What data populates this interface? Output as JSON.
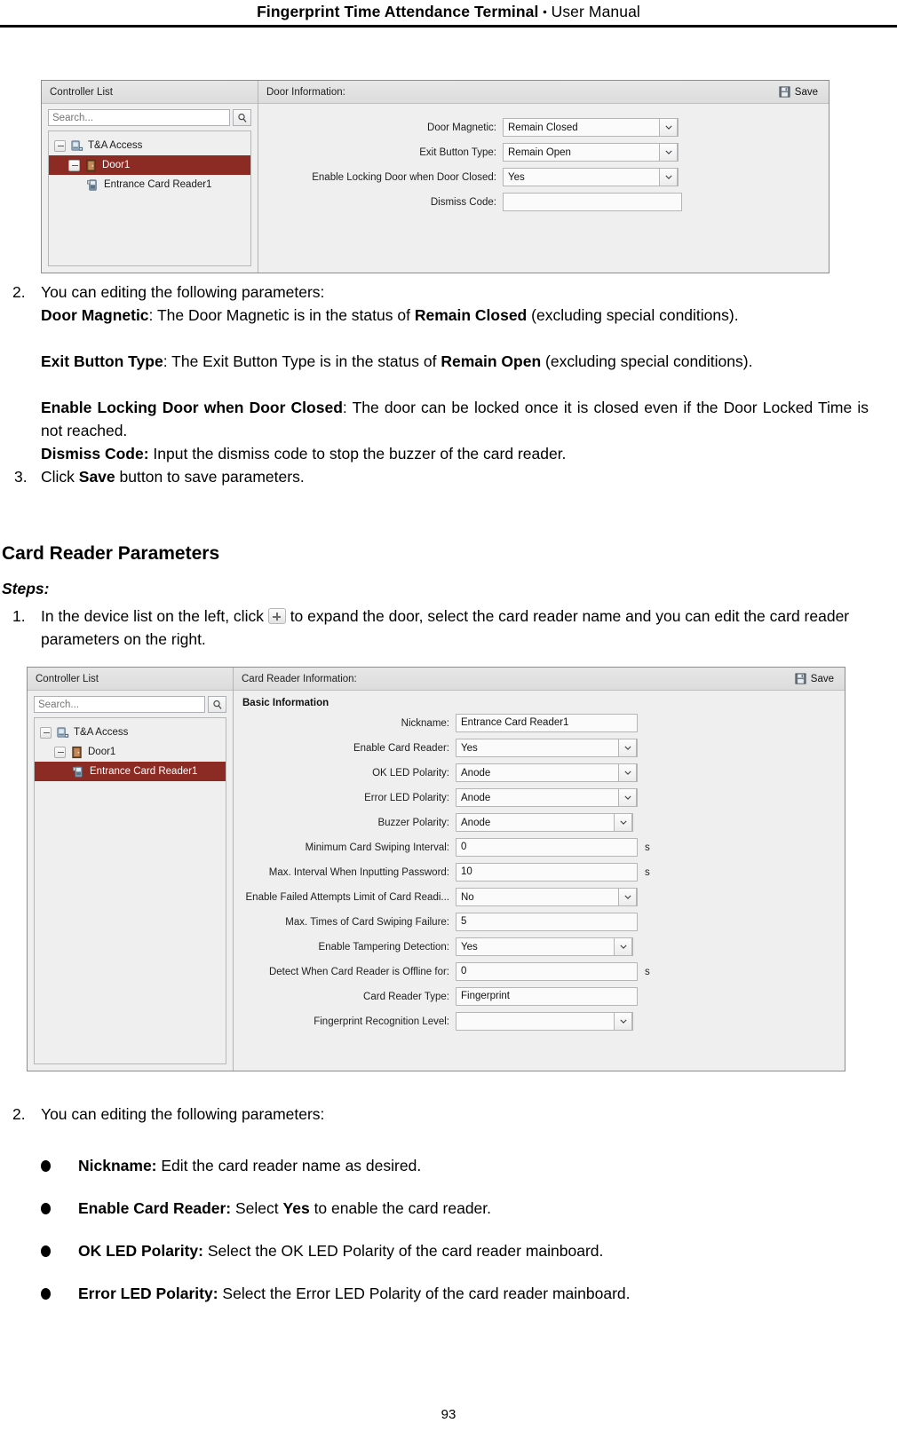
{
  "page": {
    "header_title_bold": "Fingerprint Time Attendance Terminal",
    "header_sep": "・",
    "header_title_rest": "User Manual",
    "page_number": "93"
  },
  "screenshot_door": {
    "left_pane": {
      "title": "Controller List",
      "search_placeholder": "Search...",
      "search_value": "",
      "search_icon": "magnifier-icon",
      "tree": [
        {
          "label": "T&A Access",
          "level": 1,
          "icon": "controller-icon",
          "expanded": true,
          "selected": false
        },
        {
          "label": "Door1",
          "level": 2,
          "icon": "door-icon",
          "expanded": true,
          "selected": true
        },
        {
          "label": "Entrance Card Reader1",
          "level": 3,
          "icon": "card-reader-icon",
          "expanded": null,
          "selected": false
        }
      ]
    },
    "right_pane": {
      "title": "Door Information:",
      "save_label": "Save",
      "save_icon": "floppy-save-icon",
      "fields": [
        {
          "label": "Door Magnetic:",
          "value": "Remain Closed",
          "type": "select",
          "unit": ""
        },
        {
          "label": "Exit Button Type:",
          "value": "Remain Open",
          "type": "select",
          "unit": ""
        },
        {
          "label": "Enable Locking Door when Door Closed:",
          "value": "Yes",
          "type": "select",
          "unit": ""
        },
        {
          "label": "Dismiss Code:",
          "value": "",
          "type": "text",
          "unit": ""
        }
      ]
    }
  },
  "body_1": {
    "step2_num": "2.",
    "step2_text": "You can editing the following parameters:",
    "p_door_magnetic_label": "Door Magnetic",
    "p_door_magnetic_text_a": ": The Door Magnetic is in the status of ",
    "p_door_magnetic_bold": "Remain Closed",
    "p_door_magnetic_text_b": " (excluding special conditions).",
    "p_exit_label": "Exit Button Type",
    "p_exit_text_a": ": The Exit Button Type is in the status of ",
    "p_exit_bold": "Remain Open",
    "p_exit_text_b": " (excluding special conditions).",
    "p_lock_label": "Enable Locking Door when Door Closed",
    "p_lock_text": ": The door can be locked once it is closed even if the Door Locked Time is not reached.",
    "p_dismiss_label": "Dismiss Code:",
    "p_dismiss_text": " Input the dismiss code to stop the buzzer of the card reader.",
    "step3_num": "3.",
    "step3_text_a": "Click ",
    "step3_bold": "Save",
    "step3_text_b": " button to save parameters."
  },
  "section": {
    "heading": "Card Reader Parameters",
    "steps_label": "Steps:",
    "step1_num": "1.",
    "step1_text_a": "In the device list on the left, click ",
    "step1_icon": "expand-plus-icon",
    "step1_text_b": " to expand the door, select the card reader name and you can edit the card reader parameters on the right."
  },
  "screenshot_reader": {
    "left_pane": {
      "title": "Controller List",
      "search_placeholder": "Search...",
      "search_value": "",
      "search_icon": "magnifier-icon",
      "tree": [
        {
          "label": "T&A Access",
          "level": 1,
          "icon": "controller-icon",
          "expanded": true,
          "selected": false
        },
        {
          "label": "Door1",
          "level": 2,
          "icon": "door-icon",
          "expanded": true,
          "selected": false
        },
        {
          "label": "Entrance Card Reader1",
          "level": 3,
          "icon": "card-reader-icon",
          "expanded": null,
          "selected": true
        }
      ]
    },
    "right_pane": {
      "title": "Card Reader Information:",
      "save_label": "Save",
      "save_icon": "floppy-save-icon",
      "group_title": "Basic Information",
      "fields": [
        {
          "label": "Nickname:",
          "value": "Entrance Card Reader1",
          "type": "text",
          "unit": ""
        },
        {
          "label": "Enable Card Reader:",
          "value": "Yes",
          "type": "select",
          "unit": ""
        },
        {
          "label": "OK LED Polarity:",
          "value": "Anode",
          "type": "select",
          "unit": ""
        },
        {
          "label": "Error LED Polarity:",
          "value": "Anode",
          "type": "select",
          "unit": ""
        },
        {
          "label": "Buzzer Polarity:",
          "value": "Anode",
          "type": "select",
          "unit": ""
        },
        {
          "label": "Minimum Card Swiping Interval:",
          "value": "0",
          "type": "text",
          "unit": "s"
        },
        {
          "label": "Max. Interval When Inputting Password:",
          "value": "10",
          "type": "text",
          "unit": "s"
        },
        {
          "label": "Enable Failed Attempts Limit of Card Readi...",
          "value": "No",
          "type": "select",
          "unit": ""
        },
        {
          "label": "Max. Times of Card Swiping Failure:",
          "value": "5",
          "type": "text",
          "unit": ""
        },
        {
          "label": "Enable Tampering Detection:",
          "value": "Yes",
          "type": "select",
          "unit": ""
        },
        {
          "label": "Detect When Card Reader is Offline for:",
          "value": "0",
          "type": "text",
          "unit": "s"
        },
        {
          "label": "Card Reader Type:",
          "value": "Fingerprint",
          "type": "text",
          "unit": ""
        },
        {
          "label": "Fingerprint Recognition Level:",
          "value": "",
          "type": "select",
          "unit": ""
        }
      ]
    }
  },
  "body_2": {
    "step2_num": "2.",
    "step2_text": "You can editing the following parameters:",
    "bullets": [
      {
        "label": "Nickname:",
        "text_a": " Edit the card reader name as desired.",
        "bold_mid": "",
        "text_b": ""
      },
      {
        "label": "Enable Card Reader:",
        "text_a": " Select ",
        "bold_mid": "Yes",
        "text_b": " to enable the card reader."
      },
      {
        "label": "OK LED Polarity:",
        "text_a": " Select the OK LED Polarity of the card reader mainboard.",
        "bold_mid": "",
        "text_b": ""
      },
      {
        "label": "Error LED Polarity:",
        "text_a": " Select the Error LED Polarity of the card reader mainboard.",
        "bold_mid": "",
        "text_b": ""
      }
    ]
  },
  "colors": {
    "selection": "#8c2b24",
    "panel_bg": "#efefef",
    "header_bar": "#e2e2e2"
  }
}
